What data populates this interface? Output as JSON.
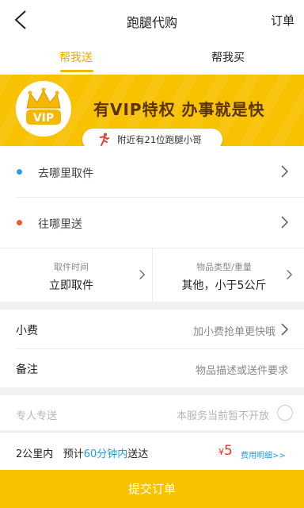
{
  "header": {
    "title": "跑腿代购",
    "order_link": "订单",
    "back_icon": "back-arrow-icon"
  },
  "tabs": [
    {
      "label": "帮我送",
      "active": true
    },
    {
      "label": "帮我买",
      "active": false
    }
  ],
  "banner": {
    "vip_slogan": "有VIP特权 办事就是快",
    "badge_text": "VIP",
    "badge_icon": "crown-icon",
    "courier_count_text": "附近有21位跑腿小哥",
    "courier_icon": "runner-icon"
  },
  "addresses": {
    "pickup_label": "去哪里取件",
    "dropoff_label": "往哪里送"
  },
  "info": {
    "pickup_time": {
      "label": "取件时间",
      "value": "立即取件"
    },
    "item_type": {
      "label": "物品类型/重量",
      "value": "其他，小于5公斤"
    }
  },
  "fees": {
    "tip": {
      "label": "小费",
      "hint": "加小费抢单更快哦"
    },
    "note": {
      "label": "备注",
      "hint": "物品描述或送件要求"
    }
  },
  "special": {
    "label": "专人专送",
    "note": "本服务当前暂不开放"
  },
  "summary": {
    "distance": "2公里内",
    "estimate_prefix": "预计",
    "estimate_time": "60分钟内",
    "estimate_suffix": "送达",
    "currency": "¥",
    "price": "5",
    "detail_link": "费用明细>>"
  },
  "submit_label": "提交订单",
  "colors": {
    "accent": "#f8c200",
    "tab_active": "#f0a800",
    "link_blue": "#1d9ce8",
    "price_red": "#e9312a"
  }
}
